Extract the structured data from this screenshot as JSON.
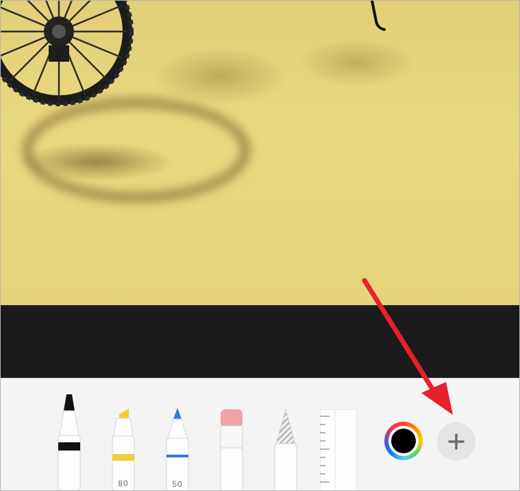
{
  "photo": {
    "description_icon": "bicycle-wheel-photo"
  },
  "toolbar": {
    "tools": [
      {
        "name": "pen",
        "icon": "pen-icon",
        "number": ""
      },
      {
        "name": "marker",
        "icon": "marker-icon",
        "number": "80"
      },
      {
        "name": "pencil",
        "icon": "pencil-icon",
        "number": "50"
      },
      {
        "name": "eraser",
        "icon": "eraser-icon",
        "number": ""
      },
      {
        "name": "lasso",
        "icon": "lasso-icon",
        "number": ""
      },
      {
        "name": "ruler",
        "icon": "ruler-icon",
        "number": ""
      }
    ],
    "color_picker": {
      "selected_color": "#000000"
    },
    "add_button": {
      "icon": "plus-icon"
    }
  },
  "annotation": {
    "arrow_color": "#e8202a",
    "arrow_icon": "red-arrow-icon"
  },
  "colors": {
    "marker_accent": "#f2cc3c",
    "pencil_accent": "#2f7ae0",
    "eraser_accent": "#f0a3a3",
    "pen_band": "#111111"
  }
}
